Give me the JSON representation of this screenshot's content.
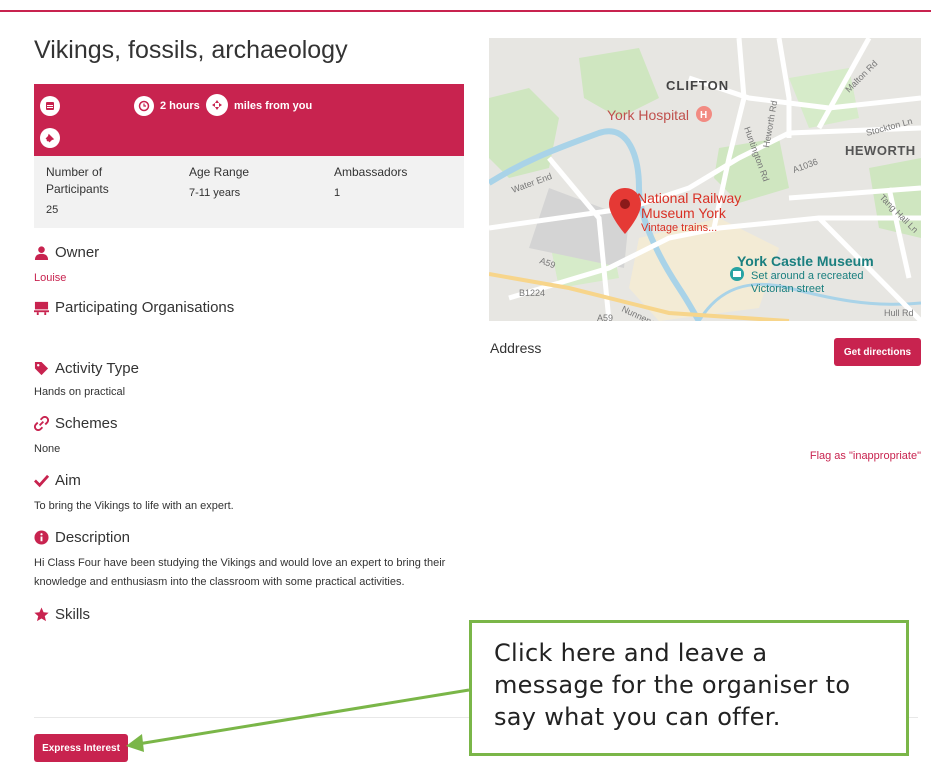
{
  "activity": {
    "title": "Vikings, fossils, archaeology",
    "duration": "2 hours",
    "distance": "miles from you"
  },
  "info_table": {
    "participants_label": "Number of Participants",
    "participants_value": "25",
    "age_label": "Age Range",
    "age_value": "7-11 years",
    "ambassadors_label": "Ambassadors",
    "ambassadors_value": "1"
  },
  "owner": {
    "heading": "Owner",
    "name": "Louise"
  },
  "organisations": {
    "heading": "Participating Organisations"
  },
  "activity_type": {
    "heading": "Activity Type",
    "value": "Hands on practical"
  },
  "schemes": {
    "heading": "Schemes",
    "value": "None"
  },
  "aim": {
    "heading": "Aim",
    "value": "To bring the Vikings to life with an expert."
  },
  "description": {
    "heading": "Description",
    "value": "Hi Class Four have been studying the Vikings and would love an expert to bring their knowledge and enthusiasm into the classroom with some practical activities."
  },
  "skills": {
    "heading": "Skills"
  },
  "actions": {
    "express_interest": "Express Interest",
    "get_directions": "Get directions",
    "flag": "Flag as \"inappropriate\""
  },
  "address": {
    "label": "Address"
  },
  "map": {
    "labels": {
      "clifton": "CLIFTON",
      "york_hospital": "York Hospital",
      "heworth": "HEWORTH",
      "nrm_1": "National Railway",
      "nrm_2": "Museum York",
      "nrm_3": "Vintage trains...",
      "ycm": "York Castle Museum",
      "ycm_2": "Set around a recreated",
      "ycm_3": "Victorian street",
      "water_end": "Water End",
      "road_a59": "A59",
      "road_b1224": "B1224",
      "road_a1036": "A1036",
      "hull_rd": "Hull Rd",
      "huntington": "Huntington Rd",
      "heworth_rd": "Heworth Rd",
      "stockton": "Stockton Ln",
      "malton": "Malton Rd",
      "nunnery": "Nunnery Ln",
      "tang_hall": "Tang Hall Ln",
      "hospital_marker": "H"
    },
    "colors": {
      "road": "#ffffff",
      "park": "#cfe6c0",
      "water": "#a9d3e8",
      "marker": "#e53935",
      "museum": "#27a3a3"
    }
  },
  "callout": {
    "text": "Click here and leave a message for the organiser to say what you can offer."
  },
  "colors": {
    "brand": "#c8234f",
    "callout_border": "#7ab648"
  }
}
